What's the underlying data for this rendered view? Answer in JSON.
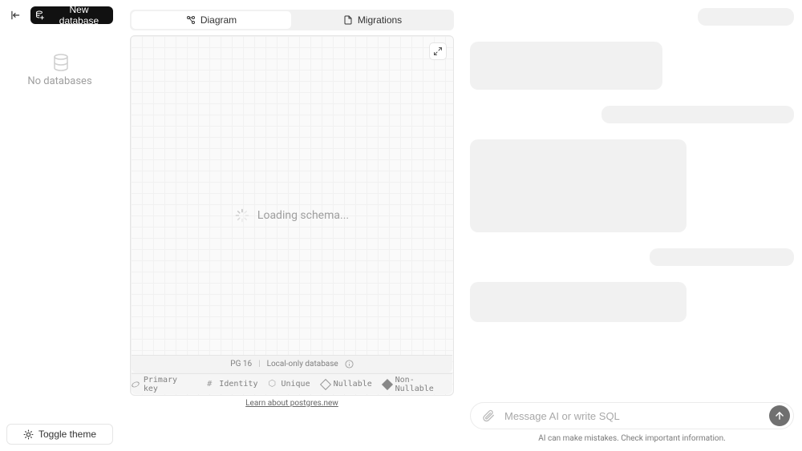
{
  "sidebar": {
    "new_db_label": "New database",
    "empty_label": "No databases",
    "theme_label": "Toggle theme"
  },
  "tabs": {
    "diagram": "Diagram",
    "migrations": "Migrations"
  },
  "diagram": {
    "loading": "Loading schema..."
  },
  "db_info": {
    "version": "PG 16",
    "scope": "Local-only database"
  },
  "legend": {
    "primary_key": "Primary key",
    "identity": "Identity",
    "unique": "Unique",
    "nullable": "Nullable",
    "non_nullable": "Non-Nullable"
  },
  "learn": {
    "label": "Learn about postgres.new"
  },
  "chat": {
    "placeholder": "Message AI or write SQL",
    "disclaimer": "AI can make mistakes. Check important information."
  }
}
